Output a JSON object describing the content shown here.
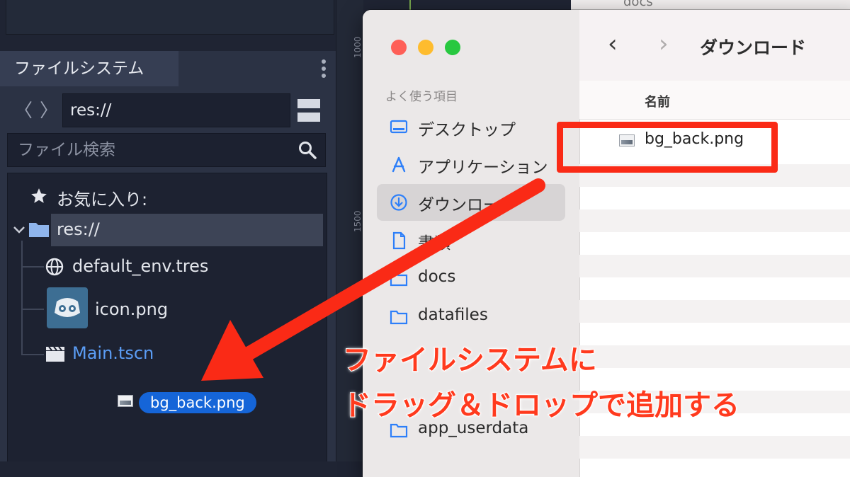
{
  "godot": {
    "filesystem_tab": "ファイルシステム",
    "nav_back": "〈",
    "nav_forward": "〉",
    "path": "res://",
    "search_placeholder": "ファイル検索",
    "favorites_label": "お気に入り:",
    "tree": {
      "root": "res://",
      "items": [
        "default_env.tres",
        "icon.png",
        "Main.tscn"
      ]
    },
    "drag_item": "bg_back.png",
    "ruler_labels": [
      "1000",
      "1500"
    ],
    "icons": {
      "favorites": "star-icon",
      "root": "folder-icon",
      "env": "globe-icon",
      "icon_png": "godot-logo-icon",
      "scene": "clapperboard-icon",
      "search": "search-icon",
      "dragged": "image-file-icon"
    },
    "colors": {
      "scene_text": "#5b9df5",
      "drag_chip": "#1565d8",
      "icon_tile": "#3d6e93"
    }
  },
  "finder": {
    "title": "ダウンロード",
    "back": "‹",
    "forward": "›",
    "sidebar_heading": "よく使う項目",
    "sidebar_items": [
      {
        "label": "デスクトップ",
        "icon": "desktop-icon"
      },
      {
        "label": "アプリケーション",
        "icon": "applications-icon"
      },
      {
        "label": "ダウンロード",
        "icon": "download-icon",
        "selected": true
      },
      {
        "label": "書類",
        "icon": "document-icon"
      },
      {
        "label": "docs",
        "icon": "folder-icon"
      },
      {
        "label": "datafiles",
        "icon": "folder-icon"
      },
      {
        "label": "app_userdata",
        "icon": "folder-icon"
      }
    ],
    "column_name": "名前",
    "files": [
      "bg_back.png"
    ],
    "background_folder": "docs"
  },
  "annotation": {
    "line1": "ファイルシステムに",
    "line2": "ドラッグ＆ドロップで追加する",
    "color": "#fa2a16"
  }
}
